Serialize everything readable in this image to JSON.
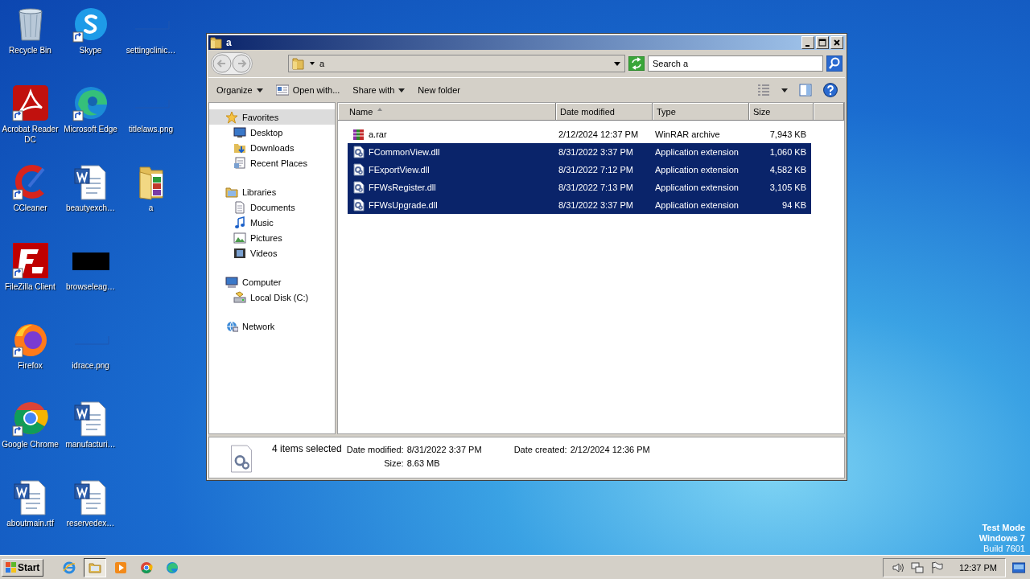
{
  "desktop": {
    "icons": [
      {
        "label": "Recycle Bin",
        "kind": "recycle",
        "shortcut": false
      },
      {
        "label": "Acrobat Reader DC",
        "kind": "acrobat",
        "shortcut": true
      },
      {
        "label": "CCleaner",
        "kind": "ccleaner",
        "shortcut": true
      },
      {
        "label": "FileZilla Client",
        "kind": "filezilla",
        "shortcut": true
      },
      {
        "label": "Firefox",
        "kind": "firefox",
        "shortcut": true
      },
      {
        "label": "Google Chrome",
        "kind": "chrome",
        "shortcut": true
      },
      {
        "label": "aboutmain.rtf",
        "kind": "word",
        "shortcut": false
      },
      {
        "label": "Skype",
        "kind": "skype",
        "shortcut": true
      },
      {
        "label": "Microsoft Edge",
        "kind": "edge",
        "shortcut": true
      },
      {
        "label": "beautyexch…",
        "kind": "word",
        "shortcut": false
      },
      {
        "label": "browseleag…",
        "kind": "black",
        "shortcut": false
      },
      {
        "label": "idrace.png",
        "kind": "blank",
        "shortcut": false
      },
      {
        "label": "manufacturi…",
        "kind": "word",
        "shortcut": false
      },
      {
        "label": "reservedex…",
        "kind": "word",
        "shortcut": false
      },
      {
        "label": "settingclinic…",
        "kind": "blank",
        "shortcut": false
      },
      {
        "label": "titlelaws.png",
        "kind": "blank",
        "shortcut": false
      },
      {
        "label": "a",
        "kind": "folder",
        "shortcut": false
      }
    ],
    "notice": [
      "Test Mode",
      "Windows 7",
      "Build 7601"
    ]
  },
  "window": {
    "title": "a",
    "address": {
      "path": "a"
    },
    "search": {
      "placeholder": "Search a"
    },
    "toolbar": [
      {
        "label": "Organize",
        "kind": "dropdown"
      },
      {
        "label": "Open with...",
        "kind": "icon"
      },
      {
        "label": "Share with",
        "kind": "dropdown"
      },
      {
        "label": "New folder",
        "kind": "plain"
      }
    ],
    "nav": [
      {
        "label": "Favorites",
        "kind": "star",
        "selected": true,
        "children": [
          {
            "label": "Desktop",
            "kind": "desktop",
            "selected": false
          },
          {
            "label": "Downloads",
            "kind": "downloads",
            "selected": false
          },
          {
            "label": "Recent Places",
            "kind": "recent",
            "selected": false
          }
        ]
      },
      {
        "label": "Libraries",
        "kind": "libraries",
        "selected": false,
        "children": [
          {
            "label": "Documents",
            "kind": "documents",
            "selected": false
          },
          {
            "label": "Music",
            "kind": "music",
            "selected": false
          },
          {
            "label": "Pictures",
            "kind": "pictures",
            "selected": false
          },
          {
            "label": "Videos",
            "kind": "videos",
            "selected": false
          }
        ]
      },
      {
        "label": "Computer",
        "kind": "computer",
        "selected": false,
        "children": [
          {
            "label": "Local Disk (C:)",
            "kind": "disk",
            "selected": false
          }
        ]
      },
      {
        "label": "Network",
        "kind": "network",
        "selected": false
      }
    ],
    "columns": [
      {
        "label": "Name",
        "sorted": true
      },
      {
        "label": "Date modified",
        "sorted": false
      },
      {
        "label": "Type",
        "sorted": false
      },
      {
        "label": "Size",
        "sorted": false
      }
    ],
    "rows": [
      {
        "name": "a.rar",
        "date": "2/12/2024 12:37 PM",
        "type": "WinRAR archive",
        "size": "7,943 KB",
        "kind": "rar",
        "selected": false
      },
      {
        "name": "FCommonView.dll",
        "date": "8/31/2022 3:37 PM",
        "type": "Application extension",
        "size": "1,060 KB",
        "kind": "dll",
        "selected": true
      },
      {
        "name": "FExportView.dll",
        "date": "8/31/2022 7:12 PM",
        "type": "Application extension",
        "size": "4,582 KB",
        "kind": "dll",
        "selected": true
      },
      {
        "name": "FFWsRegister.dll",
        "date": "8/31/2022 7:13 PM",
        "type": "Application extension",
        "size": "3,105 KB",
        "kind": "dll",
        "selected": true
      },
      {
        "name": "FFWsUpgrade.dll",
        "date": "8/31/2022 3:37 PM",
        "type": "Application extension",
        "size": "94 KB",
        "kind": "dll",
        "selected": true
      }
    ],
    "details": {
      "count": "4 items selected",
      "groups": [
        [
          {
            "label": "Date modified:",
            "value": "8/31/2022 3:37 PM"
          },
          {
            "label": "Size:",
            "value": "8.63 MB"
          }
        ],
        [
          {
            "label": "Date created:",
            "value": "2/12/2024 12:36 PM"
          }
        ]
      ]
    }
  },
  "taskbar": {
    "start": "Start",
    "apps": [
      {
        "kind": "ie",
        "selected": false
      },
      {
        "kind": "explorer",
        "selected": true
      },
      {
        "kind": "media",
        "selected": false
      },
      {
        "kind": "chrome",
        "selected": false
      },
      {
        "kind": "edge",
        "selected": false
      }
    ],
    "tray": [
      {
        "kind": "speaker"
      },
      {
        "kind": "network"
      },
      {
        "kind": "flag"
      }
    ],
    "clock": "12:37 PM"
  }
}
